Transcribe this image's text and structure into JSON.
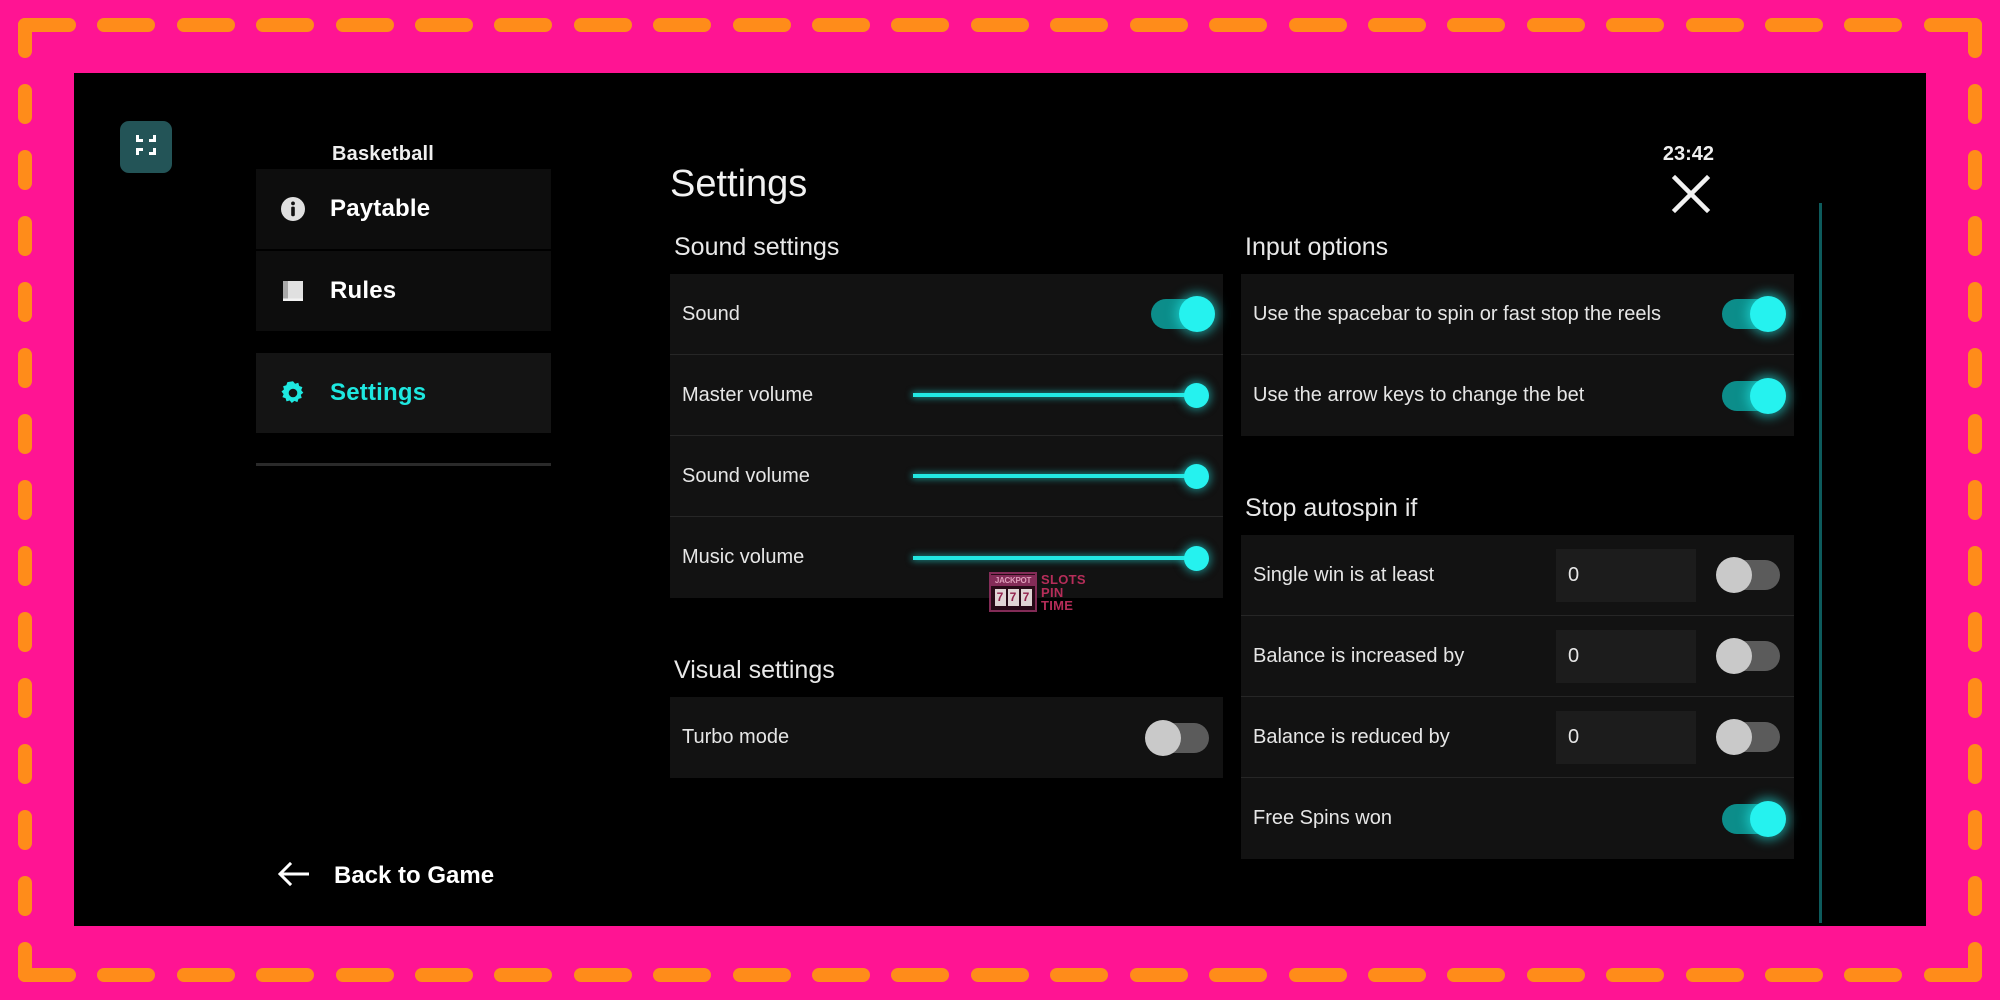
{
  "frame": {
    "bg_color": "#FF1493",
    "dash_color": "#FF8C1A"
  },
  "header": {
    "game_title": "Basketball",
    "clock": "23:42",
    "fullscreen_icon": "exit-fullscreen-icon"
  },
  "sidebar": {
    "items": [
      {
        "label": "Paytable",
        "icon": "info-circle-icon",
        "active": false
      },
      {
        "label": "Rules",
        "icon": "book-icon",
        "active": false
      },
      {
        "label": "Settings",
        "icon": "gear-icon",
        "active": true
      }
    ],
    "back_label": "Back to Game",
    "back_icon": "arrow-left-icon"
  },
  "panel": {
    "title": "Settings",
    "close_icon": "close-icon",
    "sections": {
      "sound": {
        "heading": "Sound settings",
        "rows": [
          {
            "label": "Sound",
            "control": "toggle",
            "value": "on"
          },
          {
            "label": "Master volume",
            "control": "slider",
            "value": 100
          },
          {
            "label": "Sound volume",
            "control": "slider",
            "value": 100
          },
          {
            "label": "Music volume",
            "control": "slider",
            "value": 100
          }
        ]
      },
      "visual": {
        "heading": "Visual settings",
        "rows": [
          {
            "label": "Turbo mode",
            "control": "toggle",
            "value": "off"
          }
        ]
      },
      "input": {
        "heading": "Input options",
        "rows": [
          {
            "label": "Use the spacebar to spin or fast stop the reels",
            "control": "toggle",
            "value": "on"
          },
          {
            "label": "Use the arrow keys to change the bet",
            "control": "toggle",
            "value": "on"
          }
        ]
      },
      "autospin": {
        "heading": "Stop autospin if",
        "rows": [
          {
            "label": "Single win is at least",
            "control": "field+toggle",
            "field_value": "0",
            "value": "off"
          },
          {
            "label": "Balance is increased by",
            "control": "field+toggle",
            "field_value": "0",
            "value": "off"
          },
          {
            "label": "Balance is reduced by",
            "control": "field+toggle",
            "field_value": "0",
            "value": "off"
          },
          {
            "label": "Free Spins won",
            "control": "toggle",
            "value": "on"
          }
        ]
      }
    }
  },
  "watermark": {
    "jackpot": "JACKPOT",
    "reels": [
      "7",
      "7",
      "7"
    ],
    "line1": "SLOTS",
    "line2": "PIN",
    "line3": "TIME"
  },
  "colors": {
    "accent_cyan": "#25f2ef",
    "accent_teal": "#0c8d8a",
    "screen_bg": "#000000",
    "card_bg": "#121212"
  }
}
